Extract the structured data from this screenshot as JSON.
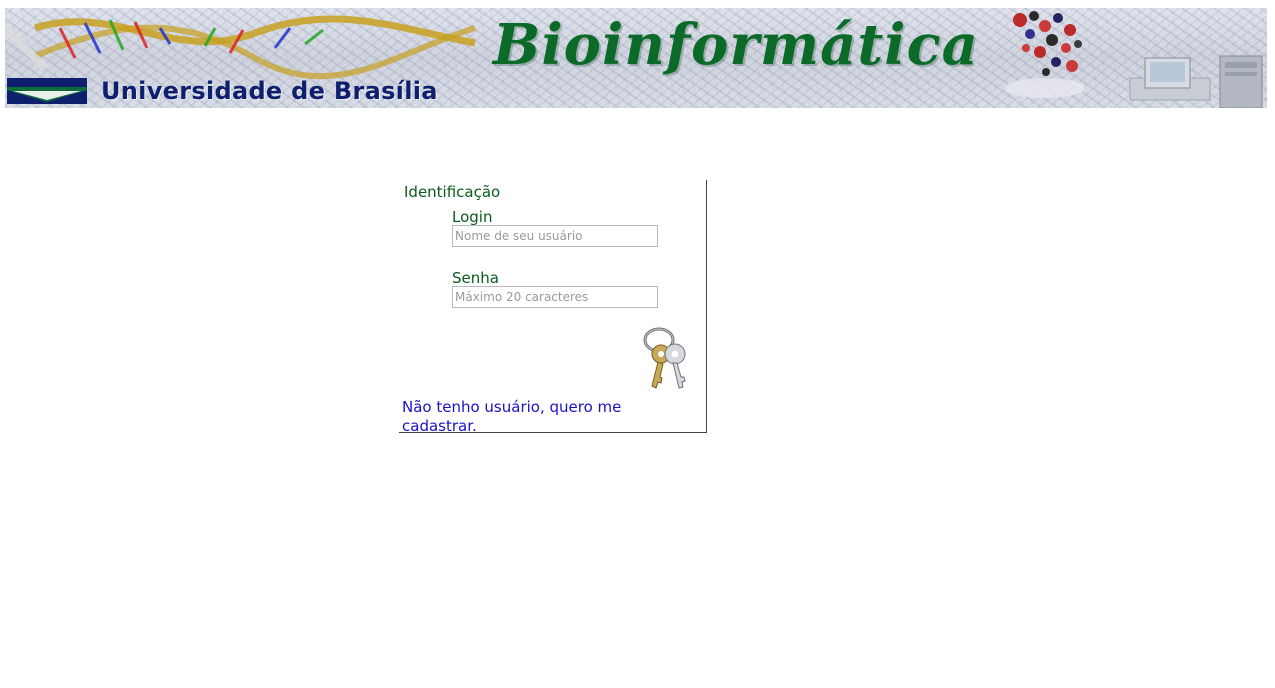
{
  "banner": {
    "university_name": "Universidade de Brasília",
    "title": "Bioinformática"
  },
  "login_panel": {
    "legend": "Identificação",
    "login_label": "Login",
    "login_placeholder": "Nome de seu usuário",
    "login_value": "",
    "password_label": "Senha",
    "password_placeholder": "Máximo 20 caracteres",
    "password_value": "",
    "submit_icon": "keys-icon",
    "register_link": "Não tenho usuário, quero me cadastrar."
  },
  "colors": {
    "label_green": "#0b5a1e",
    "title_green": "#0b6a28",
    "link_blue": "#1a12c8",
    "unb_blue": "#0e1f6e",
    "unb_green": "#0f6b3a"
  }
}
